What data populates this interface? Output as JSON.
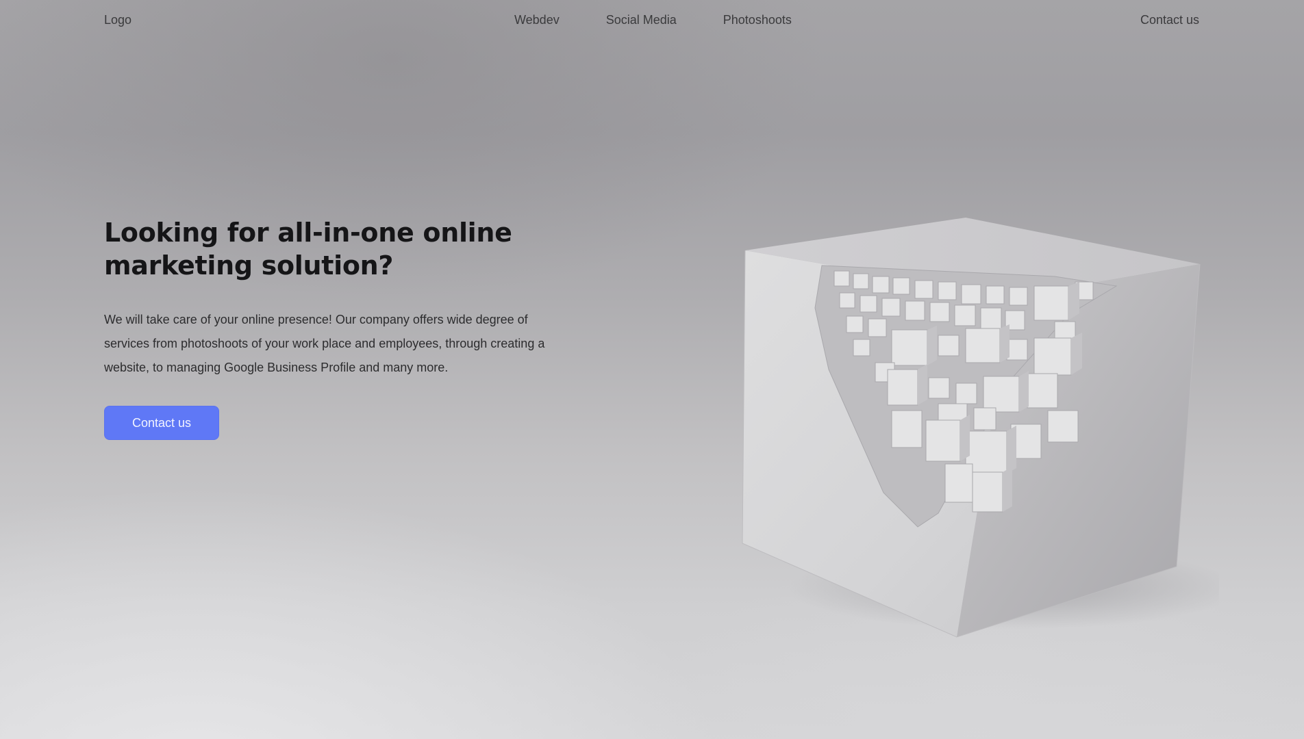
{
  "header": {
    "logo": "Logo",
    "nav": [
      {
        "label": "Webdev"
      },
      {
        "label": "Social Media"
      },
      {
        "label": "Photoshoots"
      }
    ],
    "contact": "Contact us"
  },
  "hero": {
    "title": "Looking for all-in-one online marketing solution?",
    "description": "We will take care of your online presence! Our company offers wide degree of services from photoshoots of your work place and employees, through creating a website, to managing Google Business Profile and many more.",
    "cta_label": "Contact us"
  },
  "colors": {
    "accent": "#5f78f6",
    "text": "#151517"
  },
  "icons": {
    "hero_image": "pixelated-cube-illustration"
  }
}
